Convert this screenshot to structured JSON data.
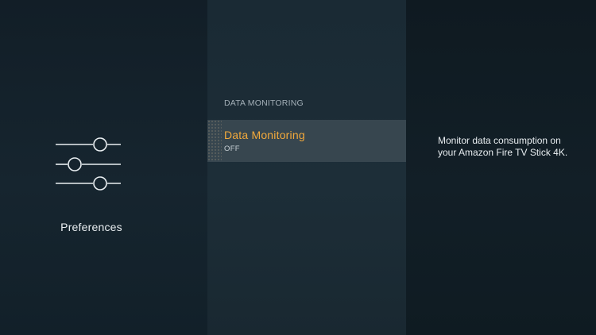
{
  "left_panel": {
    "icon": "sliders-icon",
    "category_label": "Preferences"
  },
  "middle_panel": {
    "section_header": "DATA MONITORING",
    "items": [
      {
        "title": "Data Monitoring",
        "value": "OFF",
        "focused": true
      }
    ]
  },
  "right_panel": {
    "description": "Monitor data consumption on your Amazon Fire TV Stick 4K."
  },
  "colors": {
    "accent": "#f2a93b",
    "focus_background": "#37464f",
    "text_primary": "#e9eef1",
    "text_secondary": "#a3afb7"
  }
}
